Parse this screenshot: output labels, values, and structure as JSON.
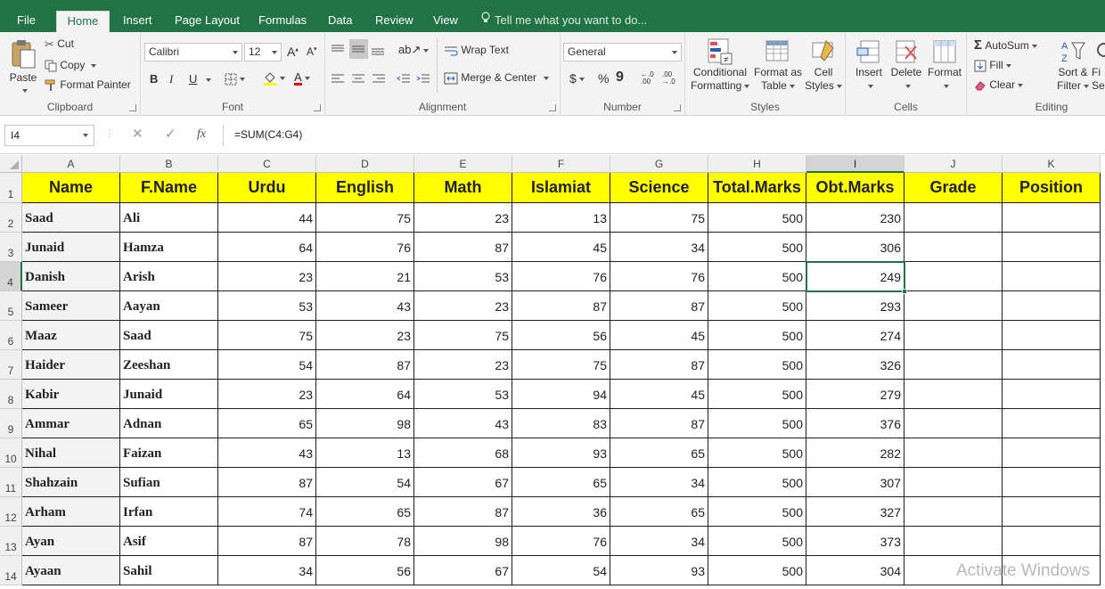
{
  "tabs": [
    {
      "label": "File"
    },
    {
      "label": "Home"
    },
    {
      "label": "Insert"
    },
    {
      "label": "Page Layout"
    },
    {
      "label": "Formulas"
    },
    {
      "label": "Data"
    },
    {
      "label": "Review"
    },
    {
      "label": "View"
    }
  ],
  "active_tab": "Home",
  "tell_me": "Tell me what you want to do...",
  "ribbon": {
    "clipboard": {
      "label": "Clipboard",
      "paste": "Paste",
      "cut": "Cut",
      "copy": "Copy",
      "format_painter": "Format Painter"
    },
    "font": {
      "label": "Font",
      "font_name": "Calibri",
      "font_size": "12",
      "bold": "B",
      "italic": "I",
      "underline": "U"
    },
    "alignment": {
      "label": "Alignment",
      "wrap_text": "Wrap Text",
      "merge_center": "Merge & Center"
    },
    "number": {
      "label": "Number",
      "format": "General",
      "currency": "$",
      "percent": "%",
      "comma": "9"
    },
    "styles": {
      "label": "Styles",
      "conditional": "Conditional",
      "conditional2": "Formatting",
      "format_as": "Format as",
      "format_as2": "Table",
      "cell": "Cell",
      "cell2": "Styles"
    },
    "cells": {
      "label": "Cells",
      "insert": "Insert",
      "delete": "Delete",
      "format": "Format"
    },
    "editing": {
      "label": "Editing",
      "autosum": "AutoSum",
      "fill": "Fill",
      "clear": "Clear",
      "sort": "Sort &",
      "sort2": "Filter",
      "find": "Fi",
      "find2": "Sel"
    }
  },
  "formula_bar": {
    "name_box": "I4",
    "formula": "=SUM(C4:G4)",
    "fx": "fx"
  },
  "columns": [
    "A",
    "B",
    "C",
    "D",
    "E",
    "F",
    "G",
    "H",
    "I",
    "J",
    "K"
  ],
  "selected_column": "I",
  "selected_row": 4,
  "headers": [
    "Name",
    "F.Name",
    "Urdu",
    "English",
    "Math",
    "Islamiat",
    "Science",
    "Total.Marks",
    "Obt.Marks",
    "Grade",
    "Position"
  ],
  "rows": [
    [
      "Saad",
      "Ali",
      "44",
      "75",
      "23",
      "13",
      "75",
      "500",
      "230",
      "",
      ""
    ],
    [
      "Junaid",
      "Hamza",
      "64",
      "76",
      "87",
      "45",
      "34",
      "500",
      "306",
      "",
      ""
    ],
    [
      "Danish",
      "Arish",
      "23",
      "21",
      "53",
      "76",
      "76",
      "500",
      "249",
      "",
      ""
    ],
    [
      "Sameer",
      "Aayan",
      "53",
      "43",
      "23",
      "87",
      "87",
      "500",
      "293",
      "",
      ""
    ],
    [
      "Maaz",
      "Saad",
      "75",
      "23",
      "75",
      "56",
      "45",
      "500",
      "274",
      "",
      ""
    ],
    [
      "Haider",
      "Zeeshan",
      "54",
      "87",
      "23",
      "75",
      "87",
      "500",
      "326",
      "",
      ""
    ],
    [
      "Kabir",
      "Junaid",
      "23",
      "64",
      "53",
      "94",
      "45",
      "500",
      "279",
      "",
      ""
    ],
    [
      "Ammar",
      "Adnan",
      "65",
      "98",
      "43",
      "83",
      "87",
      "500",
      "376",
      "",
      ""
    ],
    [
      "Nihal",
      "Faizan",
      "43",
      "13",
      "68",
      "93",
      "65",
      "500",
      "282",
      "",
      ""
    ],
    [
      "Shahzain",
      "Sufian",
      "87",
      "54",
      "67",
      "65",
      "34",
      "500",
      "307",
      "",
      ""
    ],
    [
      "Arham",
      "Irfan",
      "74",
      "65",
      "87",
      "36",
      "65",
      "500",
      "327",
      "",
      ""
    ],
    [
      "Ayan",
      "Asif",
      "87",
      "78",
      "98",
      "76",
      "34",
      "500",
      "373",
      "",
      ""
    ],
    [
      "Ayaan",
      "Sahil",
      "34",
      "56",
      "67",
      "54",
      "93",
      "500",
      "304",
      "",
      ""
    ]
  ],
  "row_numbers": [
    "1",
    "2",
    "3",
    "4",
    "5",
    "6",
    "7",
    "8",
    "9",
    "10",
    "11",
    "12",
    "13",
    "14"
  ],
  "watermark": "Activate Windows",
  "colors": {
    "accent": "#217346",
    "header_fill": "#ffff00",
    "grid_line": "#1f1f1f"
  }
}
